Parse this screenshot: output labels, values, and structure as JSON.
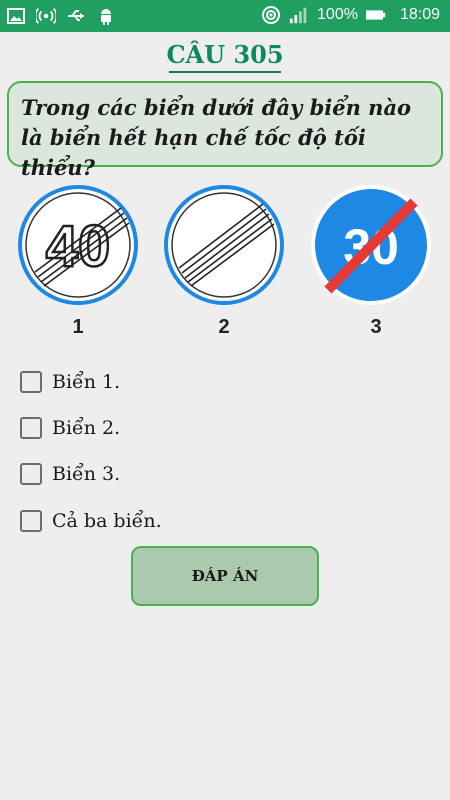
{
  "status_bar": {
    "battery": "100%",
    "time": "18:09",
    "icons": [
      "image-icon",
      "hotspot-icon",
      "usb-icon",
      "android-icon",
      "wifi-icon",
      "signal-icon",
      "battery-icon"
    ]
  },
  "question": {
    "number": "CÂU 305",
    "text": "Trong các biển dưới đây biển nào là biển hết hạn chế tốc độ tối thiểu?"
  },
  "signs": [
    {
      "number": "1",
      "value": "40"
    },
    {
      "number": "2"
    },
    {
      "number": "3",
      "value": "30"
    }
  ],
  "options": [
    {
      "label": "Biển 1.",
      "checked": false
    },
    {
      "label": "Biển 2.",
      "checked": false
    },
    {
      "label": "Biển 3.",
      "checked": false
    },
    {
      "label": "Cả ba biển.",
      "checked": false
    }
  ],
  "answer_button": "ĐÁP ÁN",
  "colors": {
    "status_bar": "#20a060",
    "title": "#0d8a5a",
    "question_bg": "#dbe7dd",
    "accent_border": "#4caf50",
    "button_bg": "#abc9ad",
    "sign_blue": "#1e88e5",
    "sign_red": "#e53935"
  }
}
